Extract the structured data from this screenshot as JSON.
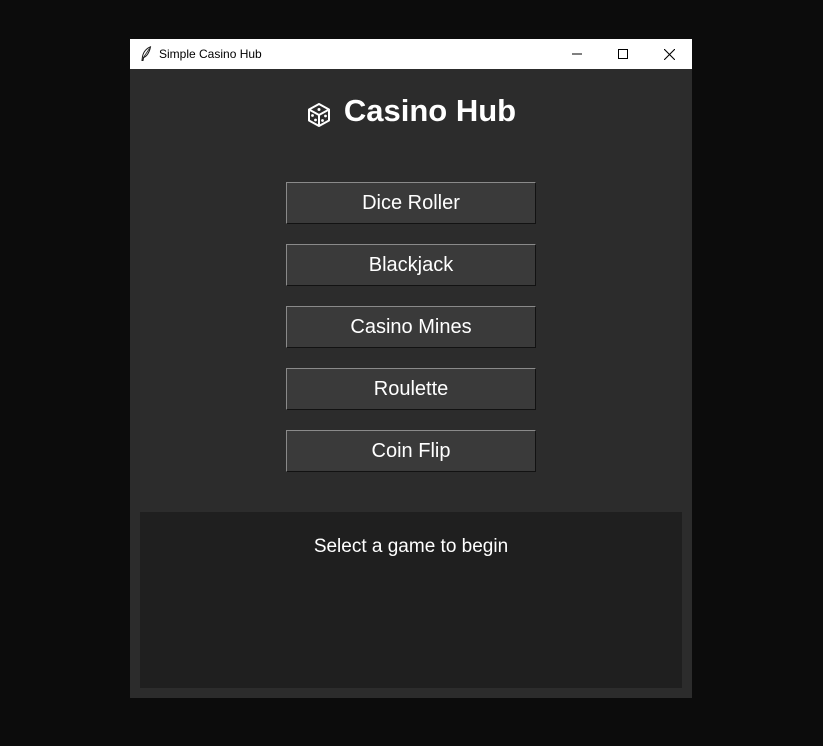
{
  "window": {
    "title": "Simple Casino Hub",
    "controls": {
      "minimize_icon": "minimize-icon",
      "maximize_icon": "maximize-icon",
      "close_icon": "close-icon"
    }
  },
  "header": {
    "icon": "dice-icon",
    "title": "Casino Hub"
  },
  "games": [
    {
      "label": "Dice Roller"
    },
    {
      "label": "Blackjack"
    },
    {
      "label": "Casino Mines"
    },
    {
      "label": "Roulette"
    },
    {
      "label": "Coin Flip"
    }
  ],
  "status": {
    "message": "Select a game to begin"
  },
  "colors": {
    "desktop_bg": "#0c0c0c",
    "window_bg": "#2c2c2c",
    "button_bg": "#3a3a3a",
    "status_bg": "#1f1f1f",
    "text": "#ffffff"
  }
}
